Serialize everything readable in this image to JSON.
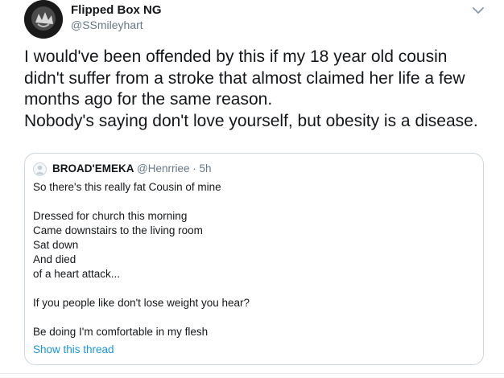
{
  "tweet": {
    "display_name": "Flipped Box NG",
    "handle": "@SSmileyhart",
    "text_lines": [
      "I would've been offended by this if my 18 year old cousin",
      "didn't suffer from a stroke that almost claimed her life a few",
      "months ago for the same reason.",
      "Nobody's saying don't love yourself, but obesity is a disease."
    ],
    "more_icon": "chevron-down-icon"
  },
  "quoted_tweet": {
    "display_name": "BROAD'EMEKA",
    "handle_time": "@Henrriee · 5h",
    "lines": [
      "So there's this really fat Cousin of mine",
      "",
      "Dressed for church this morning",
      "Came downstairs to the living room",
      "Sat down",
      "And died",
      "of a heart attack...",
      "",
      "If you people like don't lose weight you hear?",
      "",
      "Be doing I'm comfortable in my flesh"
    ],
    "show_thread": "Show this thread"
  },
  "colors": {
    "primary_text": "#14171a",
    "secondary_text": "#657786",
    "link": "#1b95e0",
    "border": "#ccd6dd"
  }
}
